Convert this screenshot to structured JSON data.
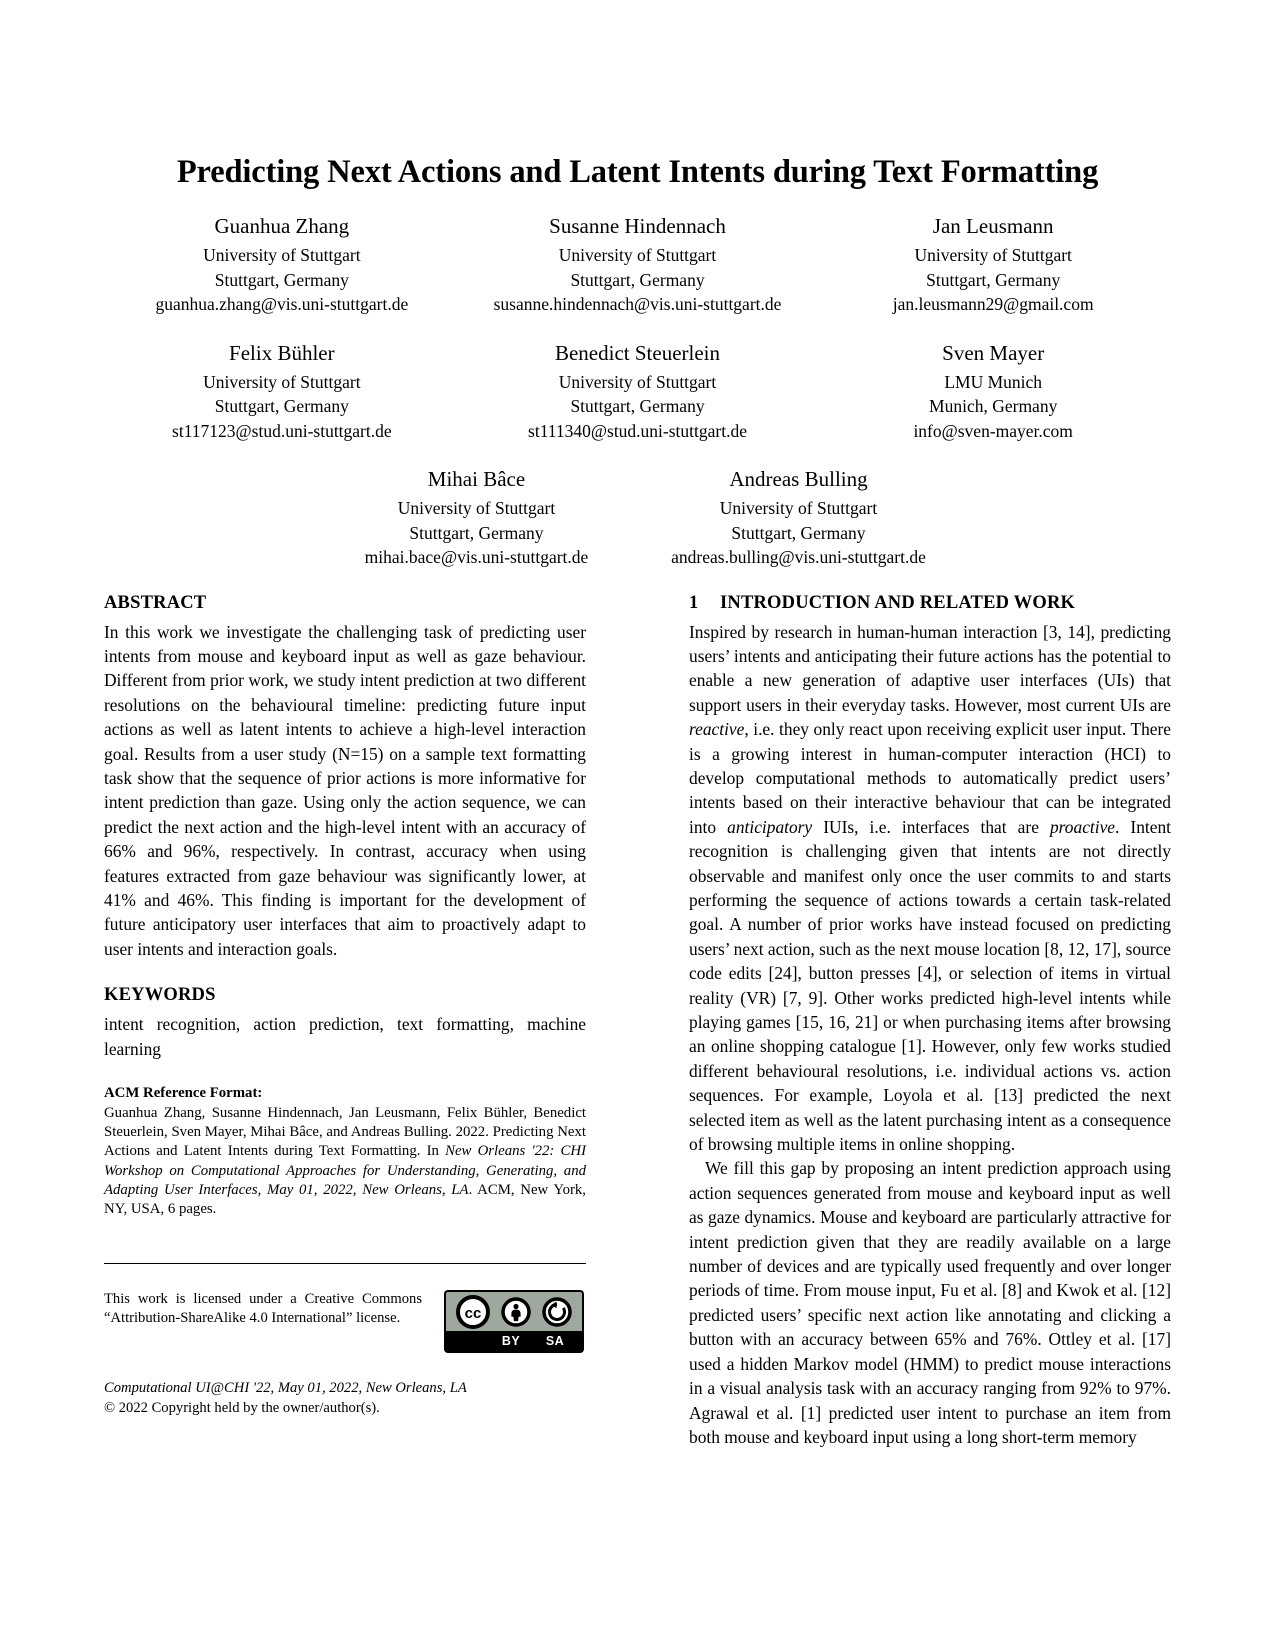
{
  "paper": {
    "title": "Predicting Next Actions and Latent Intents during Text Formatting",
    "authors_row1": [
      {
        "name": "Guanhua Zhang",
        "affiliation": "University of Stuttgart",
        "location": "Stuttgart, Germany",
        "email": "guanhua.zhang@vis.uni-stuttgart.de"
      },
      {
        "name": "Susanne Hindennach",
        "affiliation": "University of Stuttgart",
        "location": "Stuttgart, Germany",
        "email": "susanne.hindennach@vis.uni-stuttgart.de"
      },
      {
        "name": "Jan Leusmann",
        "affiliation": "University of Stuttgart",
        "location": "Stuttgart, Germany",
        "email": "jan.leusmann29@gmail.com"
      }
    ],
    "authors_row2": [
      {
        "name": "Felix Bühler",
        "affiliation": "University of Stuttgart",
        "location": "Stuttgart, Germany",
        "email": "st117123@stud.uni-stuttgart.de"
      },
      {
        "name": "Benedict Steuerlein",
        "affiliation": "University of Stuttgart",
        "location": "Stuttgart, Germany",
        "email": "st111340@stud.uni-stuttgart.de"
      },
      {
        "name": "Sven Mayer",
        "affiliation": "LMU Munich",
        "location": "Munich, Germany",
        "email": "info@sven-mayer.com"
      }
    ],
    "authors_row3": [
      {
        "name": "Mihai Bâce",
        "affiliation": "University of Stuttgart",
        "location": "Stuttgart, Germany",
        "email": "mihai.bace@vis.uni-stuttgart.de"
      },
      {
        "name": "Andreas Bulling",
        "affiliation": "University of Stuttgart",
        "location": "Stuttgart, Germany",
        "email": "andreas.bulling@vis.uni-stuttgart.de"
      }
    ]
  },
  "abstract": {
    "heading": "ABSTRACT",
    "text": "In this work we investigate the challenging task of predicting user intents from mouse and keyboard input as well as gaze behaviour. Different from prior work, we study intent prediction at two different resolutions on the behavioural timeline: predicting future input actions as well as latent intents to achieve a high-level interaction goal. Results from a user study (N=15) on a sample text formatting task show that the sequence of prior actions is more informative for intent prediction than gaze. Using only the action sequence, we can predict the next action and the high-level intent with an accuracy of 66% and 96%, respectively. In contrast, accuracy when using features extracted from gaze behaviour was significantly lower, at 41% and 46%. This finding is important for the development of future anticipatory user interfaces that aim to proactively adapt to user intents and interaction goals."
  },
  "keywords": {
    "heading": "KEYWORDS",
    "text": "intent recognition, action prediction, text formatting, machine learning"
  },
  "acm_reference": {
    "heading": "ACM Reference Format:",
    "part1": "Guanhua Zhang, Susanne Hindennach, Jan Leusmann, Felix Bühler, Benedict Steuerlein, Sven Mayer, Mihai Bâce, and Andreas Bulling. 2022. Predicting Next Actions and Latent Intents during Text Formatting. In ",
    "venue_italic": "New Orleans '22: CHI Workshop on Computational Approaches for Understanding, Generating, and Adapting User Interfaces, May 01, 2022, New Orleans, LA",
    "part2": ". ACM, New York, NY, USA, 6 pages."
  },
  "license": {
    "text_line1": "This work is licensed under a Creative Commons",
    "text_line2": "“Attribution-ShareAlike 4.0 International” license.",
    "badge": {
      "cc_label": "cc",
      "by_label": "BY",
      "sa_label": "SA",
      "background": "#9ea89e"
    },
    "venue_line": "Computational UI@CHI '22, May 01, 2022, New Orleans, LA",
    "copyright_line": "© 2022 Copyright held by the owner/author(s)."
  },
  "introduction": {
    "number": "1",
    "heading": "INTRODUCTION AND RELATED WORK",
    "paragraph1_a": "Inspired by research in human-human interaction [3, 14], predicting users’ intents and anticipating their future actions has the potential to enable a new generation of adaptive user interfaces (UIs) that support users in their everyday tasks. However, most current UIs are ",
    "paragraph1_reactive": "reactive",
    "paragraph1_b": ", i.e. they only react upon receiving explicit user input. There is a growing interest in human-computer interaction (HCI) to develop computational methods to automatically predict users’ intents based on their interactive behaviour that can be integrated into ",
    "paragraph1_anticipatory": "anticipatory",
    "paragraph1_c": " IUIs, i.e. interfaces that are ",
    "paragraph1_proactive": "proactive",
    "paragraph1_d": ". Intent recognition is challenging given that intents are not directly observable and manifest only once the user commits to and starts performing the sequence of actions towards a certain task-related goal. A number of prior works have instead focused on predicting users’ next action, such as the next mouse location [8, 12, 17], source code edits [24], button presses [4], or selection of items in virtual reality (VR) [7, 9]. Other works predicted high-level intents while playing games [15, 16, 21] or when purchasing items after browsing an online shopping catalogue [1]. However, only few works studied different behavioural resolutions, i.e. individual actions vs. action sequences. For example, Loyola et al. [13] predicted the next selected item as well as the latent purchasing intent as a consequence of browsing multiple items in online shopping.",
    "paragraph2": "We fill this gap by proposing an intent prediction approach using action sequences generated from mouse and keyboard input as well as gaze dynamics. Mouse and keyboard are particularly attractive for intent prediction given that they are readily available on a large number of devices and are typically used frequently and over longer periods of time. From mouse input, Fu et al. [8] and Kwok et al. [12] predicted users’ specific next action like annotating and clicking a button with an accuracy between 65% and 76%. Ottley et al. [17] used a hidden Markov model (HMM) to predict mouse interactions in a visual analysis task with an accuracy ranging from 92% to 97%. Agrawal et al. [1] predicted user intent to purchase an item from both mouse and keyboard input using a long short-term memory"
  }
}
